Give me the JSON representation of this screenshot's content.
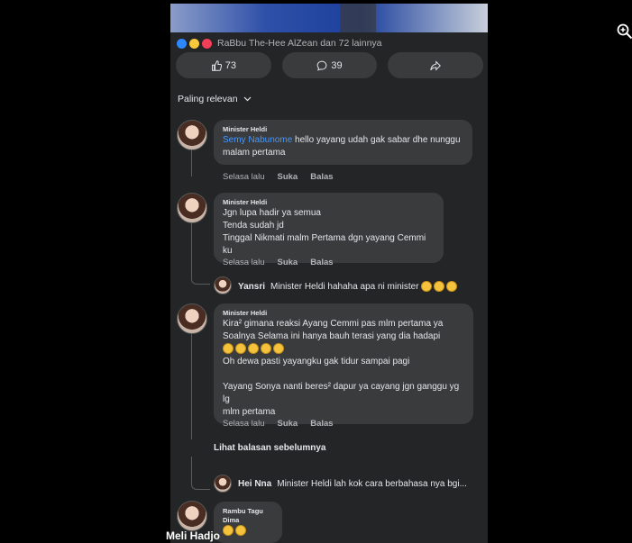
{
  "reactions": {
    "text": "RaBbu The-Hee AlZean dan 72 lainnya"
  },
  "actions": {
    "like_count": "73",
    "comment_count": "39"
  },
  "sort": {
    "label": "Paling relevan"
  },
  "comments": [
    {
      "name": "Minister Heldi",
      "mention": "Semy Nabunome",
      "text": " hello yayang udah gak sabar dhe nunggu malam pertama",
      "time": "Selasa lalu",
      "like": "Suka",
      "reply": "Balas"
    },
    {
      "name": "Minister Heldi",
      "lines": [
        "Jgn lupa hadir ya semua",
        "Tenda sudah jd",
        "Tinggal Nikmati malm Pertama dgn yayang Cemmi ku"
      ],
      "time": "Selasa lalu",
      "like": "Suka",
      "reply": "Balas"
    },
    {
      "name": "Minister Heldi",
      "lines": [
        "Kira² gimana reaksi Ayang Cemmi pas mlm pertama ya",
        "Soalnya Selama ini hanya bauh terasi yang dia hadapi",
        "",
        "Oh dewa pasti yayangku gak tidur sampai pagi",
        "",
        "Yayang Sonya nanti beres² dapur ya cayang jgn ganggu yg lg",
        "mlm pertama"
      ],
      "time": "Selasa lalu",
      "like": "Suka",
      "reply": "Balas"
    }
  ],
  "replies": [
    {
      "name": "Yansri",
      "text": "Minister Heldi hahaha apa ni minister"
    },
    {
      "name": "Hei Nna",
      "text": "Minister Heldi  lah kok cara berbahasa nya bgi..."
    }
  ],
  "more_replies": "Lihat balasan sebelumnya",
  "last_comment": {
    "name": "Rambu Tagu Dima"
  },
  "footer_name": "Meli Hadjo"
}
